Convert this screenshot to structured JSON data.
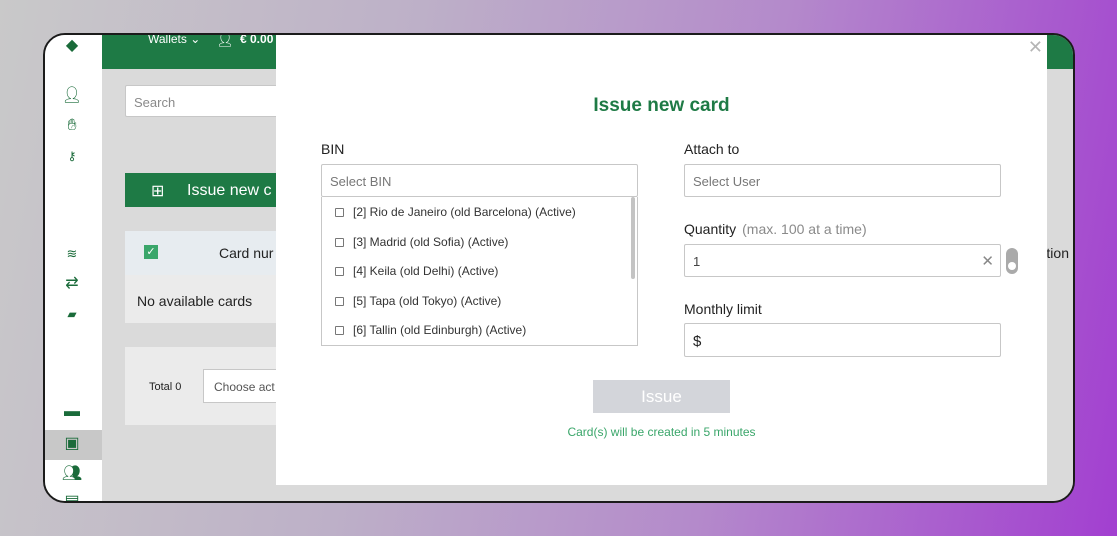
{
  "topbar": {
    "wallets_label": "Wallets",
    "balance": "€ 0.00"
  },
  "sidebar": {
    "icons": [
      "user-icon",
      "handshake-icon",
      "api-key-icon",
      "coins-icon",
      "transfer-icon",
      "money-icon",
      "card-icon",
      "wallet-icon",
      "users-icon",
      "cash-icon"
    ]
  },
  "main": {
    "search_placeholder": "Search",
    "issue_button_label": "Issue new c",
    "table_header": {
      "card_number": "Card nur",
      "right_col": "tion"
    },
    "empty_text": "No available cards",
    "total_label": "Total 0",
    "action_placeholder": "Choose act"
  },
  "modal": {
    "title": "Issue new card",
    "bin": {
      "label": "BIN",
      "placeholder": "Select BIN",
      "options": [
        "[2] Rio de Janeiro (old Barcelona) (Active)",
        "[3] Madrid (old Sofia) (Active)",
        "[4] Keila (old Delhi) (Active)",
        "[5] Tapa (old Tokyo) (Active)",
        "[6] Tallin (old Edinburgh) (Active)"
      ]
    },
    "attach": {
      "label": "Attach to",
      "placeholder": "Select User"
    },
    "quantity": {
      "label": "Quantity",
      "hint": "(max. 100 at a time)",
      "value": "1"
    },
    "monthly_limit": {
      "label": "Monthly limit",
      "value": "$"
    },
    "issue_label": "Issue",
    "note": "Card(s) will be created in 5 minutes"
  },
  "colors": {
    "brand_green": "#1e7a45",
    "note_green": "#3aa66a",
    "button_disabled": "#d3d5da"
  }
}
